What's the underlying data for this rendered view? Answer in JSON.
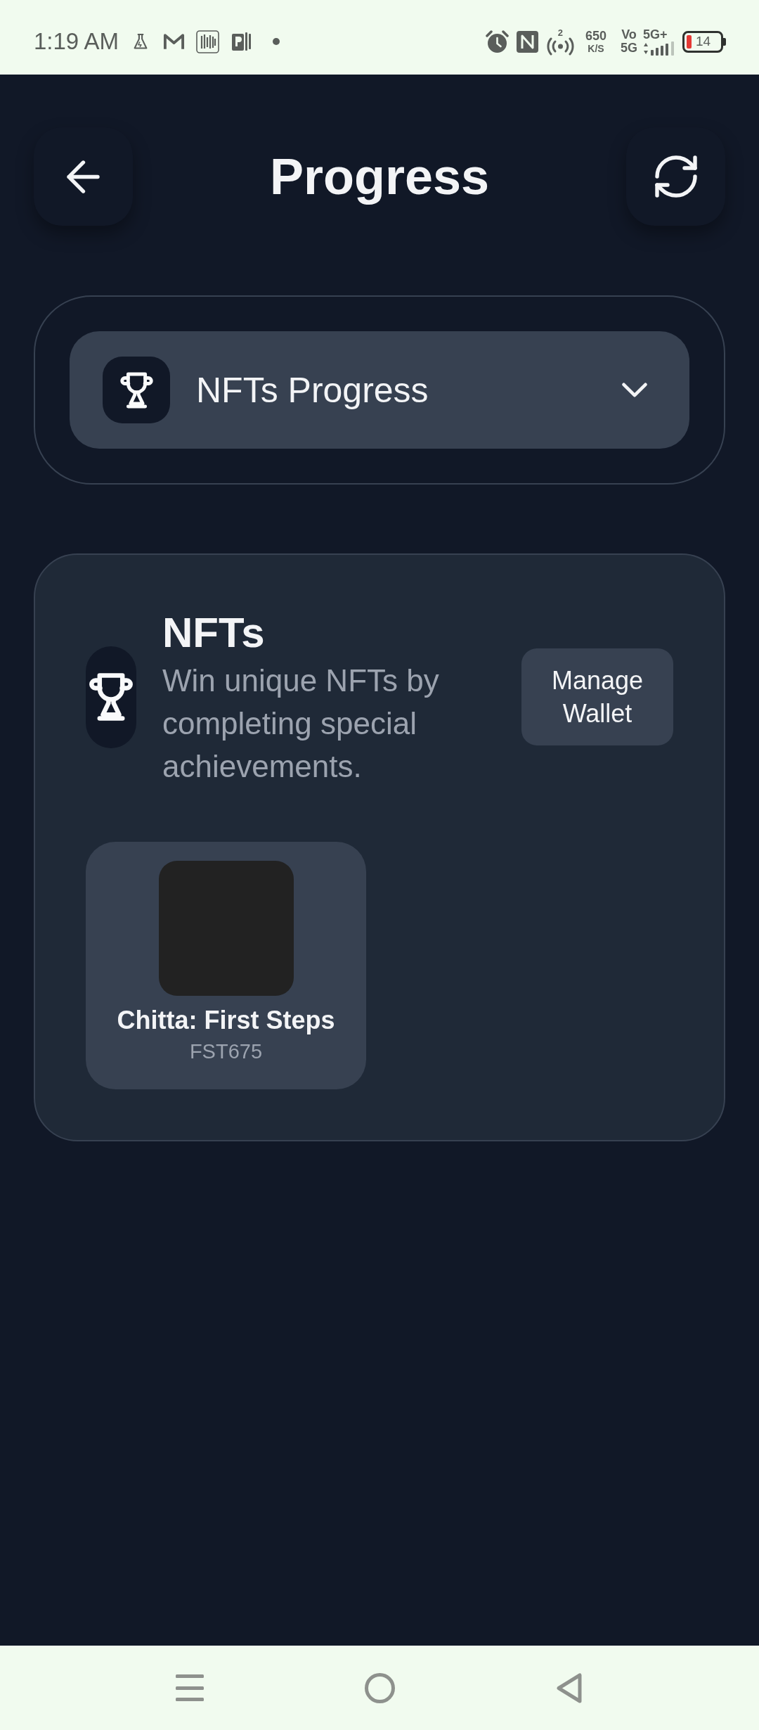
{
  "status_bar": {
    "time": "1:19 AM",
    "hotspot_count": "2",
    "speed": "650",
    "speed_unit": "K/S",
    "volte": [
      "Vo",
      "5G"
    ],
    "network": "5G+",
    "battery": "14"
  },
  "header": {
    "title": "Progress"
  },
  "selector": {
    "label": "NFTs Progress",
    "expanded": false
  },
  "nfts": {
    "title": "NFTs",
    "description": "Win unique NFTs by completing special achievements.",
    "button": "Manage Wallet",
    "items": [
      {
        "name": "Chitta: First Steps",
        "code": "FST675"
      }
    ]
  }
}
